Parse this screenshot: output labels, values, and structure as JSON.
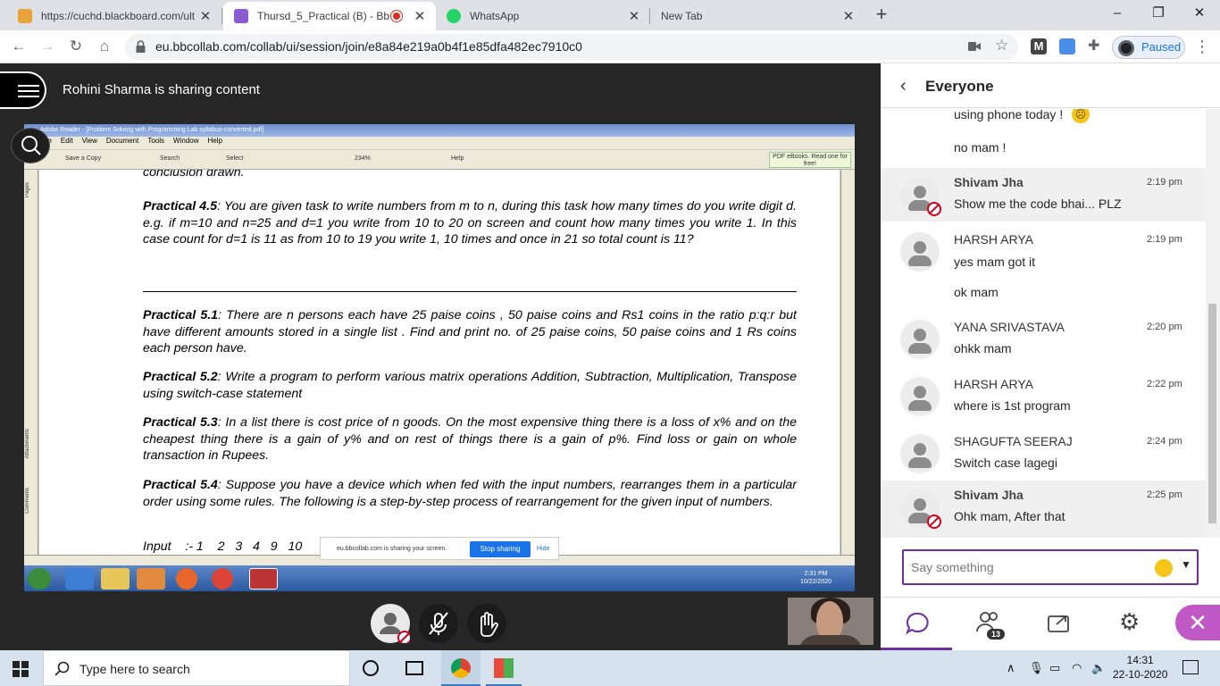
{
  "browser": {
    "tabs": [
      {
        "title": "https://cuchd.blackboard.com/ult",
        "active": false
      },
      {
        "title": "Thursd_5_Practical (B) - Bb C",
        "active": true
      },
      {
        "title": "WhatsApp",
        "active": false
      },
      {
        "title": "New Tab",
        "active": false
      }
    ],
    "url": "eu.bbcollab.com/collab/ui/session/join/e8a84e219a0b4f1e85dfa482ec7910c0",
    "profile_status": "Paused",
    "window_controls": [
      "–",
      "❐",
      "✕"
    ]
  },
  "session": {
    "sharing_label": "Rohini Sharma is sharing content"
  },
  "shared_screen": {
    "reader_title": "Adobe Reader - [Problem Solving with Programming Lab syllabus-converted.pdf]",
    "menu": [
      "File",
      "Edit",
      "View",
      "Document",
      "Tools",
      "Window",
      "Help"
    ],
    "toolbar": {
      "save": "Save a Copy",
      "search": "Search",
      "select": "Select",
      "zoom": "234%",
      "help": "Help",
      "ebooks": "PDF eBooks. Read one for free!"
    },
    "side_tabs": [
      "Pages",
      "Attachments",
      "Comments"
    ],
    "doc_fragment_top": "conclusion drawn.",
    "practicals": [
      {
        "label": "Practical 4.5",
        "text": ": You are given task to write numbers from m to n, during this task how many times do you write digit d. e.g. if m=10 and n=25 and d=1 you write from 10 to 20 on screen and count how many times you write 1. In this case count for d=1 is 11 as from 10 to 19 you write 1, 10 times and once in 21 so total count is 11?"
      },
      {
        "label": "Practical 5.1",
        "text": ": There are n persons each have 25 paise coins , 50 paise coins and Rs1 coins in the ratio p:q:r but have different amounts stored in  a single list  . Find and print no. of 25 paise coins, 50 paise coins and 1 Rs coins each person have."
      },
      {
        "label": "Practical 5.2",
        "text": ": Write a program to perform various matrix operations Addition, Subtraction, Multiplication, Transpose using switch-case statement"
      },
      {
        "label": "Practical 5.3",
        "text": ": In a list there is cost price of n goods. On the most expensive thing there is a loss of x% and on the cheapest thing there is a gain of y% and on rest of things there is a gain of p%. Find loss or gain on whole transaction in Rupees."
      },
      {
        "label": "Practical 5.4",
        "text": ": Suppose you have a device which when fed with the input numbers, rearranges them in a particular order using some rules. The following is a step-by-step process of rearrangement for the given input of numbers."
      }
    ],
    "doc_fragment_bottom": "Input    :- 1    2   3   4   9   10",
    "share_notice": "eu.bbcollab.com is sharing your screen.",
    "stop_sharing": "Stop sharing",
    "hide": "Hide",
    "xp_clock": {
      "time": "2:31 PM",
      "date": "10/22/2020"
    }
  },
  "chat": {
    "title": "Everyone",
    "messages": [
      {
        "name": "",
        "time": "",
        "text": "using phone today !"
      },
      {
        "name": "",
        "time": "",
        "text": "no mam !"
      },
      {
        "name": "Shivam Jha",
        "time": "2:19 pm",
        "text": "Show me the code bhai... PLZ",
        "moderator": true
      },
      {
        "name": "HARSH ARYA",
        "time": "2:19 pm",
        "text": "yes mam got it",
        "extra": "ok mam"
      },
      {
        "name": "YANA SRIVASTAVA",
        "time": "2:20 pm",
        "text": "ohkk mam"
      },
      {
        "name": "HARSH ARYA",
        "time": "2:22 pm",
        "text": "where is 1st program"
      },
      {
        "name": "SHAGUFTA SEERAJ",
        "time": "2:24 pm",
        "text": "Switch case lagegi"
      },
      {
        "name": "Shivam Jha",
        "time": "2:25 pm",
        "text": "Ohk mam, After that",
        "moderator": true
      }
    ],
    "input_placeholder": "Say something",
    "attendee_count": "13"
  },
  "taskbar": {
    "search_placeholder": "Type here to search",
    "time": "14:31",
    "date": "22-10-2020"
  }
}
